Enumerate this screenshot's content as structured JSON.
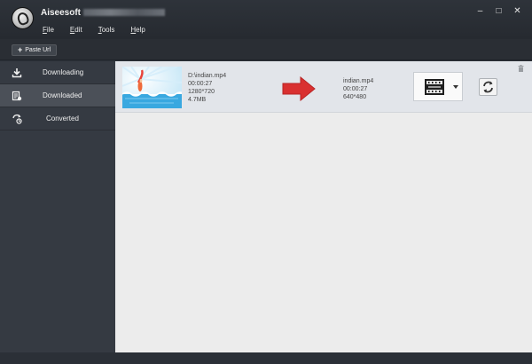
{
  "app": {
    "title": "Aiseesoft"
  },
  "menu": [
    "File",
    "Edit",
    "Tools",
    "Help"
  ],
  "window_controls": {
    "minimize": "–",
    "maximize": "□",
    "close": "✕"
  },
  "toolbar": {
    "paste_url_label": "Paste Url"
  },
  "sidebar": {
    "items": [
      {
        "label": "Downloading",
        "icon": "download-icon",
        "active": false
      },
      {
        "label": "Downloaded",
        "icon": "downloaded-list-icon",
        "active": true
      },
      {
        "label": "Converted",
        "icon": "converted-icon",
        "active": false
      }
    ]
  },
  "main": {
    "item": {
      "source_path": "D:\\indian.mp4",
      "source_duration": "00:00:27",
      "source_resolution": "1280*720",
      "source_size": "4.7MB",
      "output_name": "indian.mp4",
      "output_duration": "00:00:27",
      "output_resolution": "640*480"
    }
  },
  "colors": {
    "arrow": "#d93030",
    "sidebar_active": "#4b5058"
  }
}
